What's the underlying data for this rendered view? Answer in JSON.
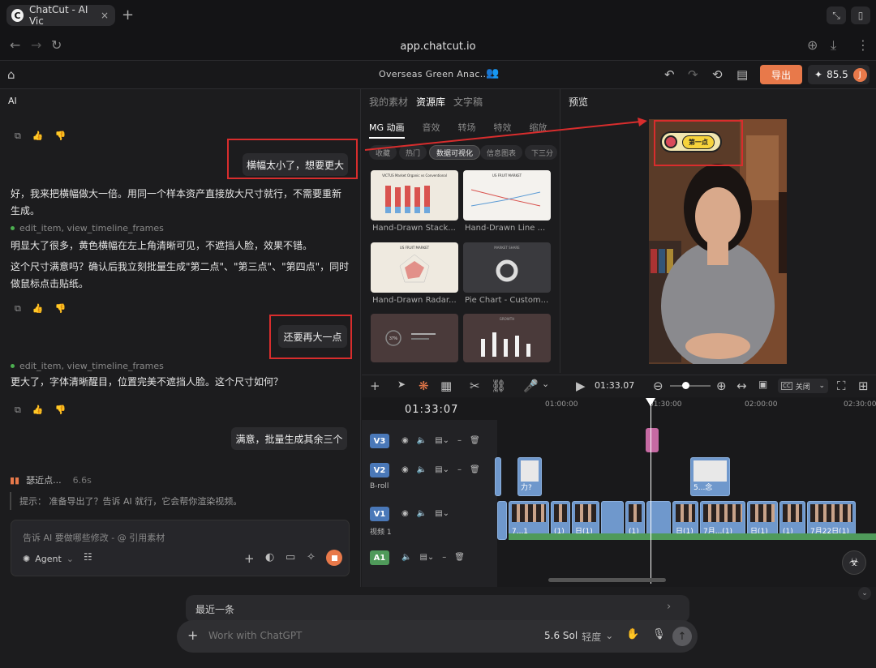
{
  "browser": {
    "tab_title": "ChatCut - AI Vic",
    "tab_close": "×",
    "new_tab": "+",
    "url": "app.chatcut.io",
    "favicon": "C"
  },
  "app": {
    "project_title": "Overseas Green Anac...",
    "export_label": "导出",
    "credits": "85.5",
    "avatar": "J",
    "accent": "#e8794a"
  },
  "chat": {
    "panel_label": "AI",
    "messages": [
      {
        "role": "user",
        "text": "横幅太小了，想要更大"
      },
      {
        "role": "assistant",
        "text": "好，我来把横幅做大一倍。用同一个样本资产直接放大尺寸就行，不需要重新生成。"
      },
      {
        "role": "tool",
        "text": "edit_item, view_timeline_frames"
      },
      {
        "role": "assistant",
        "text": "明显大了很多，黄色横幅在左上角清晰可见，不遮挡人脸，效果不错。"
      },
      {
        "role": "assistant",
        "text": "这个尺寸满意吗？确认后我立刻批量生成\"第二点\"、\"第三点\"、\"第四点\"，同时做鼠标点击贴纸。"
      },
      {
        "role": "user",
        "text": "还要再大一点"
      },
      {
        "role": "tool",
        "text": "edit_item, view_timeline_frames"
      },
      {
        "role": "assistant",
        "text": "更大了，字体清晰醒目，位置完美不遮挡人脸。这个尺寸如何？"
      },
      {
        "role": "user",
        "text": "满意，批量生成其余三个"
      }
    ],
    "thinking": "瑟近点...",
    "thinking_time": "6.6s",
    "hint": "提示：  准备导出了？告诉 AI 就行，它会帮你渲染视频。",
    "input_placeholder": "告诉 AI 要做哪些修改 - @ 引用素材",
    "agent_label": "Agent"
  },
  "assets": {
    "top_tabs": [
      "我的素材",
      "资源库",
      "文字稿"
    ],
    "active_top": "资源库",
    "sub_tabs": [
      "MG 动画",
      "音效",
      "转场",
      "特效",
      "缩放"
    ],
    "active_sub": "MG 动画",
    "chips": [
      "收藏",
      "热门",
      "数据可视化",
      "信息图表",
      "下三分"
    ],
    "active_chip": "数据可视化",
    "items": [
      {
        "caption": "Hand-Drawn Stack...",
        "inner": "VICTUS Market Organic vs Conventional"
      },
      {
        "caption": "Hand-Drawn Line ...",
        "inner": "US FRUIT MARKET"
      },
      {
        "caption": "Hand-Drawn Radar...",
        "inner": "US FRUIT MARKET"
      },
      {
        "caption": "Pie Chart - Custom...",
        "inner": "MARKET SHARE"
      },
      {
        "caption": "",
        "inner": "37%"
      },
      {
        "caption": "",
        "inner": "GROWTH"
      }
    ]
  },
  "preview": {
    "label": "预览",
    "banner_text": "第一点"
  },
  "toolbar": {
    "timecode": "01:33.07",
    "caption_toggle": "关闭"
  },
  "timeline": {
    "current_time": "01:33:07",
    "ruler": [
      "01:00:00",
      "01:30:00",
      "02:00:00",
      "02:30:00"
    ],
    "tracks": [
      {
        "id": "V3",
        "label": "",
        "color": "#4a78b8"
      },
      {
        "id": "V2",
        "label": "B-roll",
        "color": "#4a78b8"
      },
      {
        "id": "V1",
        "label": "视频 1",
        "color": "#4a78b8"
      },
      {
        "id": "A1",
        "label": "",
        "color": "#4f9a5a"
      }
    ],
    "clips_v2": [
      "力?",
      "5...念"
    ],
    "clips_v1": [
      "7...1",
      "(1)",
      "日(1)",
      "(1)",
      "日(1)",
      "7月...(1)",
      "日(1)",
      "(1)",
      "7月22日(1)"
    ]
  },
  "bottom": {
    "recent": "最近一条",
    "chat_placeholder": "Work with ChatGPT",
    "model": "5.6 Sol",
    "mode": "轻度"
  }
}
